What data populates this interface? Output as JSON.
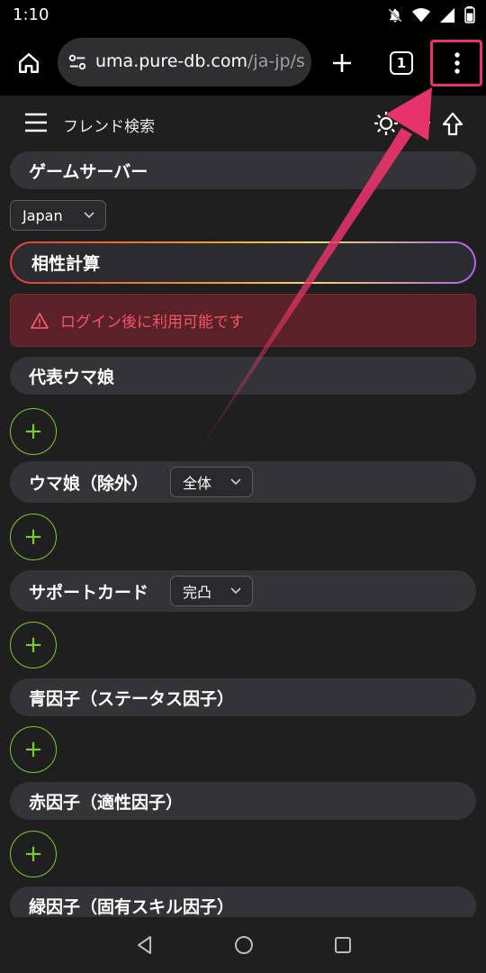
{
  "status": {
    "time": "1:10"
  },
  "browser": {
    "url_host": "uma.pure-db.com",
    "url_path": "/ja-jp/s",
    "tab_count": "1"
  },
  "app": {
    "title": "フレンド検索"
  },
  "sections": {
    "server": {
      "label": "ゲームサーバー",
      "select_value": "Japan"
    },
    "compat": {
      "label": "相性計算"
    },
    "alert": {
      "message": "ログイン後に利用可能です"
    },
    "representative": {
      "label": "代表ウマ娘"
    },
    "exclude": {
      "label": "ウマ娘（除外）",
      "select_value": "全体"
    },
    "support": {
      "label": "サポートカード",
      "select_value": "完凸"
    },
    "blue": {
      "label": "青因子（ステータス因子）"
    },
    "red": {
      "label": "赤因子（適性因子）"
    },
    "green": {
      "label": "緑因子（固有スキル因子）"
    }
  },
  "colors": {
    "accent_green": "#7ccb2f",
    "highlight_pink": "#e7336b",
    "alert_text": "#f2546a"
  },
  "icons": [
    "home-icon",
    "site-settings-icon",
    "new-tab-icon",
    "tabs-icon",
    "more-vert-icon",
    "hamburger-icon",
    "brightness-icon",
    "download-icon",
    "upload-icon",
    "warning-icon",
    "plus-icon",
    "chevron-down-icon",
    "back-icon",
    "home-nav-icon",
    "recents-icon"
  ]
}
